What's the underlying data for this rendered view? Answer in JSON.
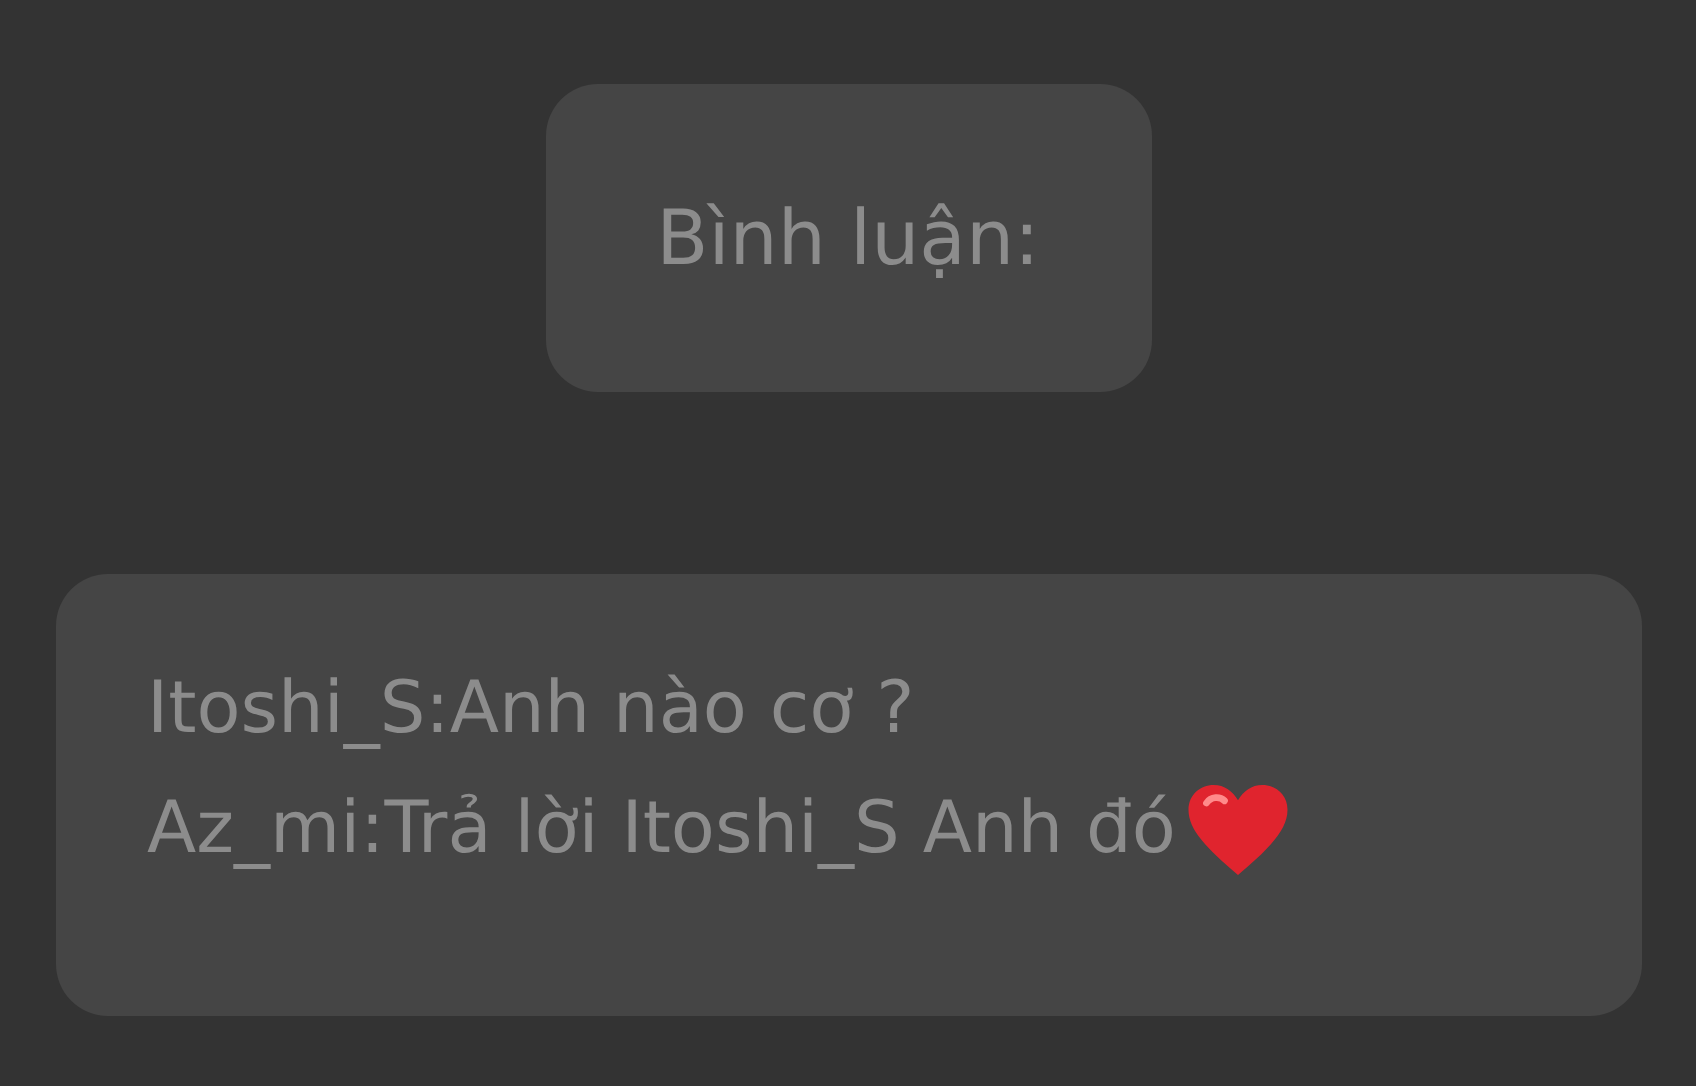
{
  "header": {
    "title": "Bình luận:"
  },
  "comments": [
    {
      "text": "Itoshi_S:Anh nào cơ ?",
      "heart": false
    },
    {
      "text": "Az_mi:Trả lời Itoshi_S Anh đó",
      "heart": true
    }
  ]
}
